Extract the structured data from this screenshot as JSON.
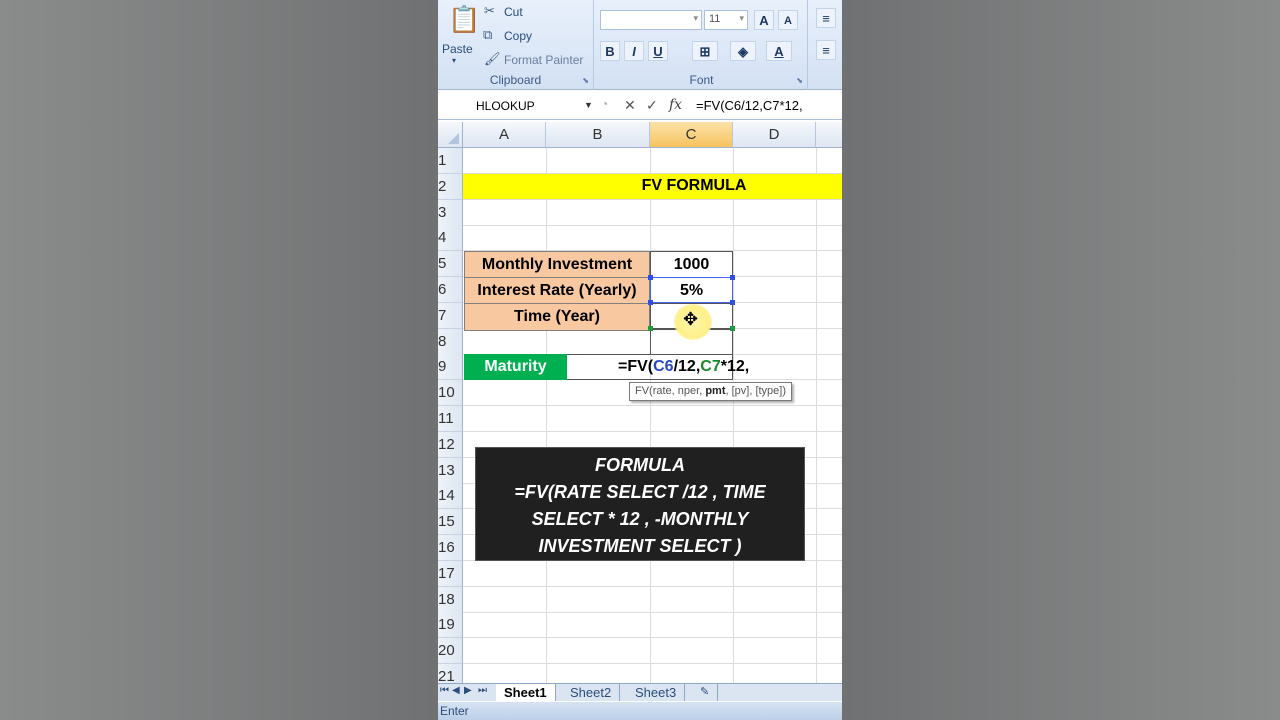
{
  "ribbon": {
    "clipboard": {
      "paste": "Paste",
      "cut": "Cut",
      "copy": "Copy",
      "format_painter": "Format Painter",
      "label": "Clipboard"
    },
    "font": {
      "size": "11",
      "bold": "B",
      "italic": "I",
      "underline": "U",
      "grow": "A",
      "shrink": "A",
      "label": "Font"
    }
  },
  "formula_bar": {
    "name_box": "HLOOKUP",
    "fx": "fx",
    "content": "=FV(C6/12,C7*12,"
  },
  "columns": [
    "A",
    "B",
    "C",
    "D"
  ],
  "rows": [
    "1",
    "2",
    "3",
    "4",
    "5",
    "6",
    "7",
    "8",
    "9",
    "10",
    "11",
    "12",
    "13",
    "14",
    "15",
    "16",
    "17",
    "18",
    "19",
    "20",
    "21"
  ],
  "sheet": {
    "title": "FV FORMULA",
    "monthly_investment_label": "Monthly Investment",
    "monthly_investment_value": "1000",
    "interest_label": "Interest Rate (Yearly)",
    "interest_value": "5%",
    "time_label": "Time (Year)",
    "maturity_label": "Maturity",
    "formula_prefix": "=FV(",
    "formula_ref1": "C6",
    "formula_mid": "/12,",
    "formula_ref2": "C7",
    "formula_suffix": "*12,",
    "tooltip_pre": "FV(rate, nper, ",
    "tooltip_bold": "pmt",
    "tooltip_post": ", [pv], [type])"
  },
  "caption": {
    "line1": "FORMULA",
    "line2": "=FV(RATE SELECT /12 , TIME",
    "line3": "SELECT * 12 , -MONTHLY",
    "line4": "INVESTMENT SELECT )"
  },
  "tabs": [
    "Sheet1",
    "Sheet2",
    "Sheet3"
  ],
  "status": "Enter",
  "colors": {
    "title_band": "#ffff00",
    "label_fill": "#f8c9a0",
    "maturity_fill": "#00b050",
    "caption_bg": "#202020"
  }
}
